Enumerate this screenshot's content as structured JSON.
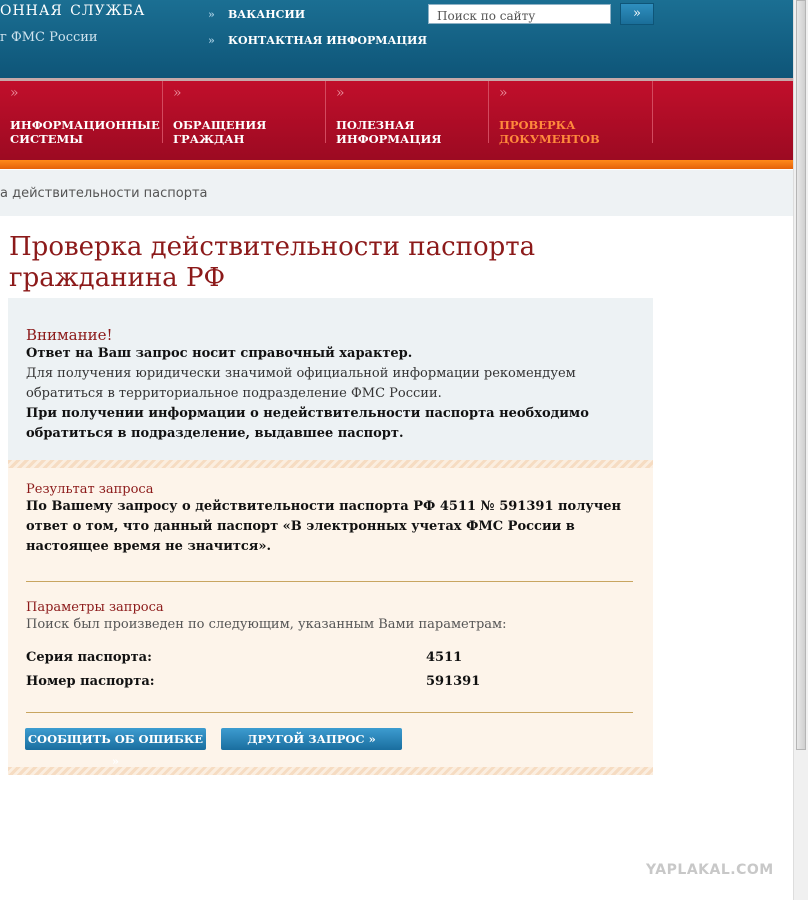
{
  "header": {
    "title": "онная служба",
    "subtitle": "г ФМС России",
    "links": [
      "ВАКАНСИИ",
      "КОНТАКТНАЯ ИНФОРМАЦИЯ"
    ],
    "search_placeholder": "Поиск по сайту",
    "search_button": "»"
  },
  "nav": {
    "arrow": "»",
    "items": [
      {
        "label": "ИНФОРМАЦИОННЫЕ СИСТЕМЫ"
      },
      {
        "label": "ОБРАЩЕНИЯ ГРАЖДАН"
      },
      {
        "label": "ПОЛЕЗНАЯ ИНФОРМАЦИЯ"
      },
      {
        "label": "ПРОВЕРКА ДОКУМЕНТОВ",
        "active": true
      }
    ]
  },
  "breadcrumb": "а действительности паспорта",
  "page_title": "Проверка действительности паспорта гражданина РФ",
  "warning": {
    "heading": "Внимание!",
    "line1": "Ответ на Ваш запрос носит справочный характер.",
    "line2": "Для получения юридически значимой официальной информации рекомендуем обратиться в территориальное подразделение ФМС России.",
    "line3": "При получении информации о недействительности паспорта необходимо обратиться в подразделение, выдавшее паспорт."
  },
  "result": {
    "heading": "Результат запроса",
    "text": "По Вашему запросу о действительности паспорта РФ 4511 № 591391 получен ответ о том, что данный паспорт «В электронных учетах ФМС России в настоящее время не значится»."
  },
  "params": {
    "heading": "Параметры запроса",
    "intro": "Поиск был произведен по следующим, указанным Вами параметрам:",
    "series_label": "Серия паспорта:",
    "series_value": "4511",
    "number_label": "Номер паспорта:",
    "number_value": "591391"
  },
  "buttons": {
    "report_error": "СООБЩИТЬ ОБ ОШИБКЕ »",
    "new_request": "ДРУГОЙ ЗАПРОС »"
  },
  "watermark": "YAPLAKAL.COM",
  "colors": {
    "header_blue": "#0e5578",
    "nav_red": "#b10d27",
    "accent_orange": "#ff8a1a",
    "title_red": "#8c1a1a",
    "button_blue": "#1a6e9f"
  }
}
